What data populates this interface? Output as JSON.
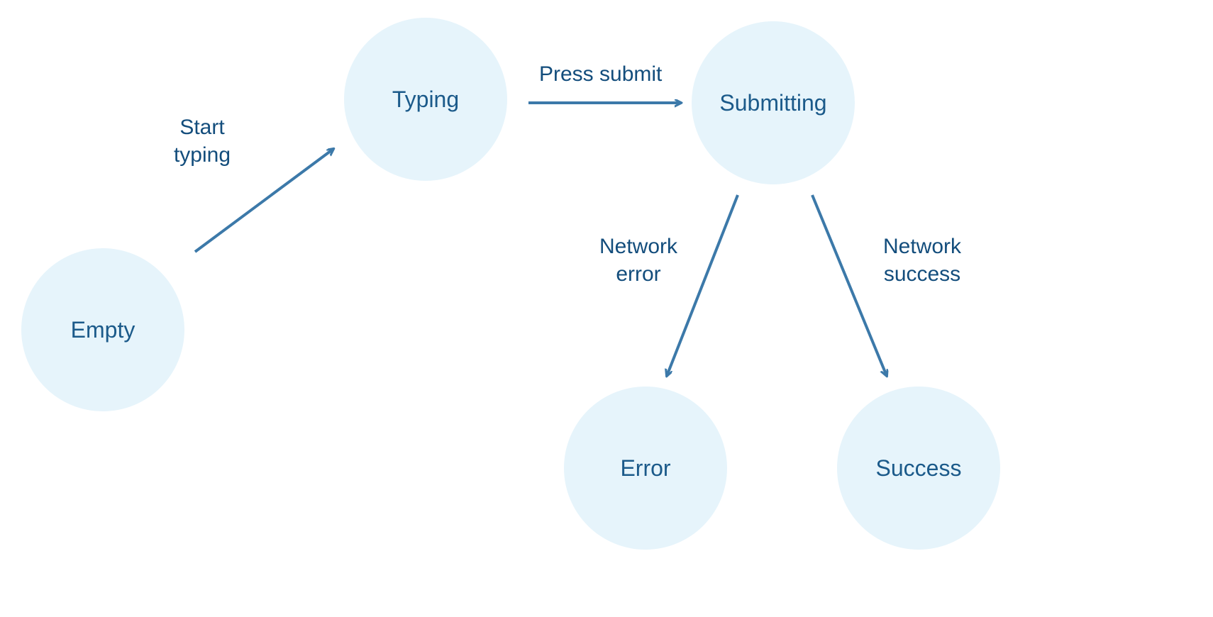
{
  "nodes": {
    "empty": {
      "label": "Empty"
    },
    "typing": {
      "label": "Typing"
    },
    "submitting": {
      "label": "Submitting"
    },
    "error": {
      "label": "Error"
    },
    "success": {
      "label": "Success"
    }
  },
  "edges": {
    "start_typing": {
      "line1": "Start",
      "line2": "typing"
    },
    "press_submit": {
      "label": "Press submit"
    },
    "network_error": {
      "line1": "Network",
      "line2": "error"
    },
    "network_success": {
      "line1": "Network",
      "line2": "success"
    }
  }
}
